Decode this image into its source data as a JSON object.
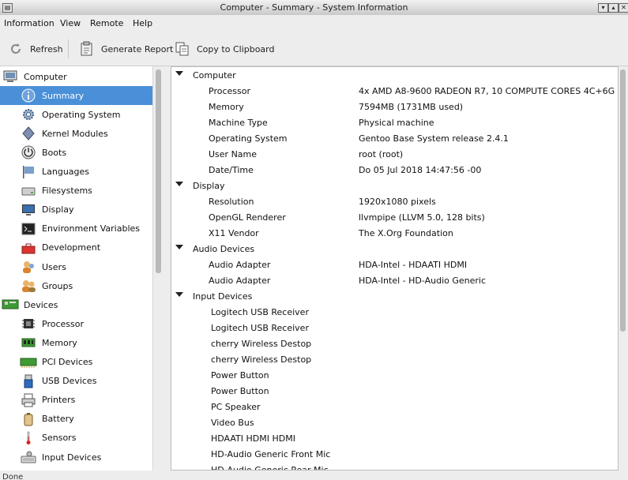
{
  "window": {
    "title": "Computer - Summary - System Information"
  },
  "menu": [
    "Information",
    "View",
    "Remote",
    "Help"
  ],
  "toolbar": {
    "refresh": "Refresh",
    "report": "Generate Report",
    "copy": "Copy to Clipboard"
  },
  "tree": [
    {
      "label": "Computer",
      "icon": "computer-icon",
      "level": 0
    },
    {
      "label": "Summary",
      "icon": "info-icon",
      "level": 1,
      "selected": true
    },
    {
      "label": "Operating System",
      "icon": "gear-icon",
      "level": 1
    },
    {
      "label": "Kernel Modules",
      "icon": "module-icon",
      "level": 1
    },
    {
      "label": "Boots",
      "icon": "power-icon",
      "level": 1
    },
    {
      "label": "Languages",
      "icon": "flag-icon",
      "level": 1
    },
    {
      "label": "Filesystems",
      "icon": "drive-icon",
      "level": 1
    },
    {
      "label": "Display",
      "icon": "monitor-icon",
      "level": 1
    },
    {
      "label": "Environment Variables",
      "icon": "terminal-icon",
      "level": 1
    },
    {
      "label": "Development",
      "icon": "toolbox-icon",
      "level": 1
    },
    {
      "label": "Users",
      "icon": "user-icon",
      "level": 1
    },
    {
      "label": "Groups",
      "icon": "group-icon",
      "level": 1
    },
    {
      "label": "Devices",
      "icon": "board-icon",
      "level": 0
    },
    {
      "label": "Processor",
      "icon": "chip-icon",
      "level": 1
    },
    {
      "label": "Memory",
      "icon": "memory-icon",
      "level": 1
    },
    {
      "label": "PCI Devices",
      "icon": "pci-icon",
      "level": 1
    },
    {
      "label": "USB Devices",
      "icon": "usb-icon",
      "level": 1
    },
    {
      "label": "Printers",
      "icon": "printer-icon",
      "level": 1
    },
    {
      "label": "Battery",
      "icon": "battery-icon",
      "level": 1
    },
    {
      "label": "Sensors",
      "icon": "thermometer-icon",
      "level": 1
    },
    {
      "label": "Input Devices",
      "icon": "keyboard-icon",
      "level": 1
    }
  ],
  "details": [
    {
      "type": "section",
      "label": "Computer"
    },
    {
      "type": "kv",
      "key": "Processor",
      "value": "4x AMD A8-9600 RADEON R7, 10 COMPUTE CORES 4C+6G"
    },
    {
      "type": "kv",
      "key": "Memory",
      "value": "7594MB (1731MB used)"
    },
    {
      "type": "kv",
      "key": "Machine Type",
      "value": "Physical machine"
    },
    {
      "type": "kv",
      "key": "Operating System",
      "value": "Gentoo Base System release 2.4.1"
    },
    {
      "type": "kv",
      "key": "User Name",
      "value": "root (root)"
    },
    {
      "type": "kv",
      "key": "Date/Time",
      "value": "Do 05 Jul 2018 14:47:56 -00"
    },
    {
      "type": "section",
      "label": "Display"
    },
    {
      "type": "kv",
      "key": "Resolution",
      "value": "1920x1080 pixels"
    },
    {
      "type": "kv",
      "key": "OpenGL Renderer",
      "value": "llvmpipe (LLVM 5.0, 128 bits)"
    },
    {
      "type": "kv",
      "key": "X11 Vendor",
      "value": "The X.Org Foundation"
    },
    {
      "type": "section",
      "label": "Audio Devices"
    },
    {
      "type": "kv",
      "key": "Audio Adapter",
      "value": "HDA-Intel - HDAATI HDMI"
    },
    {
      "type": "kv",
      "key": "Audio Adapter",
      "value": "HDA-Intel - HD-Audio Generic"
    },
    {
      "type": "section",
      "label": "Input Devices"
    },
    {
      "type": "item",
      "key": "Logitech USB Receiver"
    },
    {
      "type": "item",
      "key": "Logitech USB Receiver"
    },
    {
      "type": "item",
      "key": "cherry Wireless Destop"
    },
    {
      "type": "item",
      "key": "cherry Wireless Destop"
    },
    {
      "type": "item",
      "key": "Power Button"
    },
    {
      "type": "item",
      "key": "Power Button"
    },
    {
      "type": "item",
      "key": "PC Speaker"
    },
    {
      "type": "item",
      "key": "Video Bus"
    },
    {
      "type": "item",
      "key": "HDAATI HDMI HDMI"
    },
    {
      "type": "item",
      "key": "HD-Audio Generic Front Mic"
    },
    {
      "type": "item",
      "key": "HD-Audio Generic Rear Mic"
    }
  ],
  "status": "Done",
  "colors": {
    "selection": "#4a90d9"
  }
}
